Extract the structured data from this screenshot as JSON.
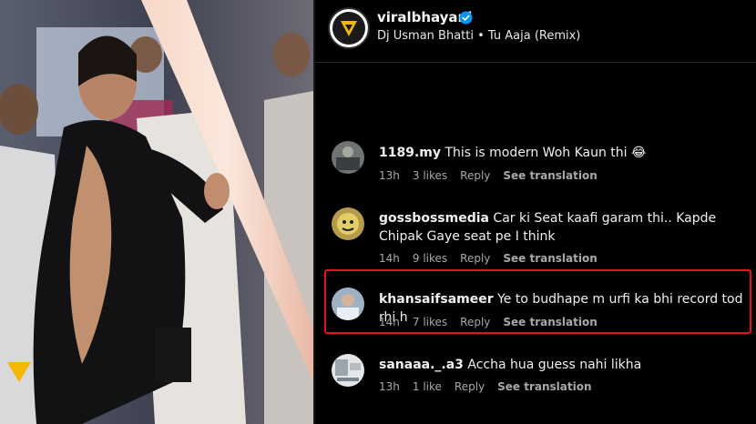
{
  "post": {
    "username": "viralbhayani",
    "audio": "Dj Usman Bhatti • Tu Aaja (Remix)"
  },
  "comments": [
    {
      "user": "1189.my",
      "text": "This is modern Woh Kaun thi 😂",
      "time": "13h",
      "likes": "3 likes",
      "reply": "Reply",
      "translate": "See translation"
    },
    {
      "user": "gossbossmedia",
      "text": "Car ki Seat kaafi garam thi.. Kapde Chipak Gaye seat pe I think",
      "time": "14h",
      "likes": "9 likes",
      "reply": "Reply",
      "translate": "See translation"
    },
    {
      "user": "khansaifsameer",
      "text": "Ye to budhape m urfi ka bhi record tod rhi h",
      "time": "14h",
      "likes": "7 likes",
      "reply": "Reply",
      "translate": "See translation"
    },
    {
      "user": "sanaaa._.a3",
      "text": "Accha hua guess nahi likha",
      "time": "13h",
      "likes": "1 like",
      "reply": "Reply",
      "translate": "See translation"
    }
  ],
  "colors": {
    "highlight": "#e8121c",
    "verified": "#0095f6",
    "watermark": "#f5b800"
  }
}
